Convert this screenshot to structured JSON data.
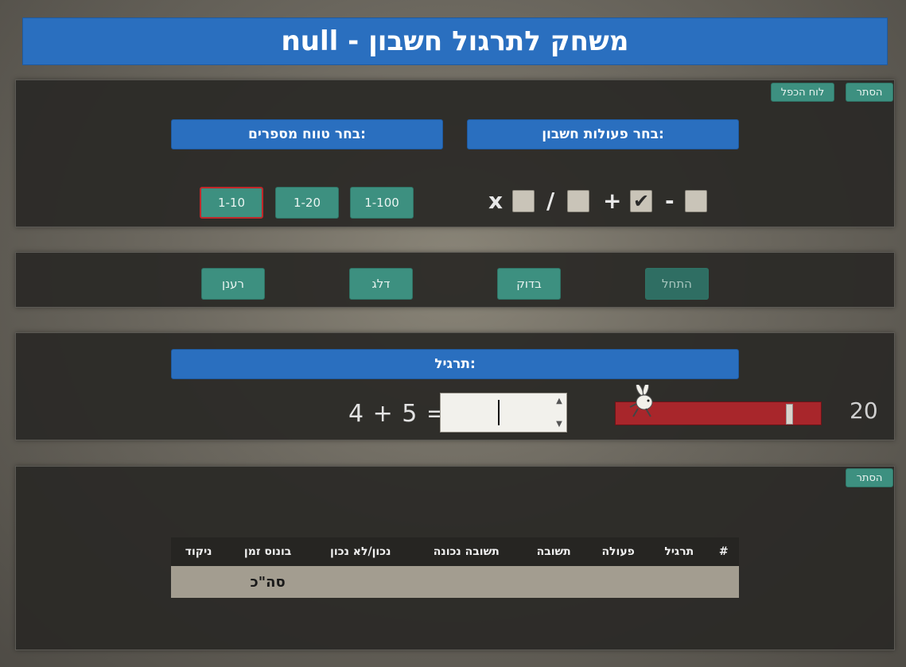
{
  "title": "null - משחק לתרגול חשבון",
  "settings": {
    "hide_label": "הסתר",
    "times_table_label": "לוח הכפל",
    "operations_header": "בחר פעולות חשבון:",
    "range_header": "בחר טווח מספרים:",
    "operations": [
      {
        "symbol": "-",
        "checked": false
      },
      {
        "symbol": "+",
        "checked": true
      },
      {
        "symbol": "/",
        "checked": false
      },
      {
        "symbol": "x",
        "checked": false
      }
    ],
    "ranges": [
      {
        "label": "1-100",
        "selected": false
      },
      {
        "label": "1-20",
        "selected": false
      },
      {
        "label": "1-10",
        "selected": true
      }
    ]
  },
  "controls": {
    "start_label": "התחל",
    "check_label": "בדוק",
    "skip_label": "דלג",
    "refresh_label": "רענן"
  },
  "exercise": {
    "header": "תרגיל:",
    "left": "4 + 5 =",
    "answer_value": "",
    "timer": "20",
    "time_remaining_fraction": 0.86
  },
  "results": {
    "hide_label": "הסתר",
    "columns": [
      "#",
      "תרגיל",
      "פעולה",
      "תשובה",
      "תשובה נכונה",
      "נכון/לא נכון",
      "בונוס זמן",
      "ניקוד"
    ],
    "total_label": "סה\"כ"
  },
  "colors": {
    "accent_blue": "#2a6fbf",
    "teal": "#3d9080",
    "time_bar": "#a8262b",
    "selected_border": "#c0282a"
  },
  "icons": {
    "runner": "running-rabbit-icon"
  }
}
